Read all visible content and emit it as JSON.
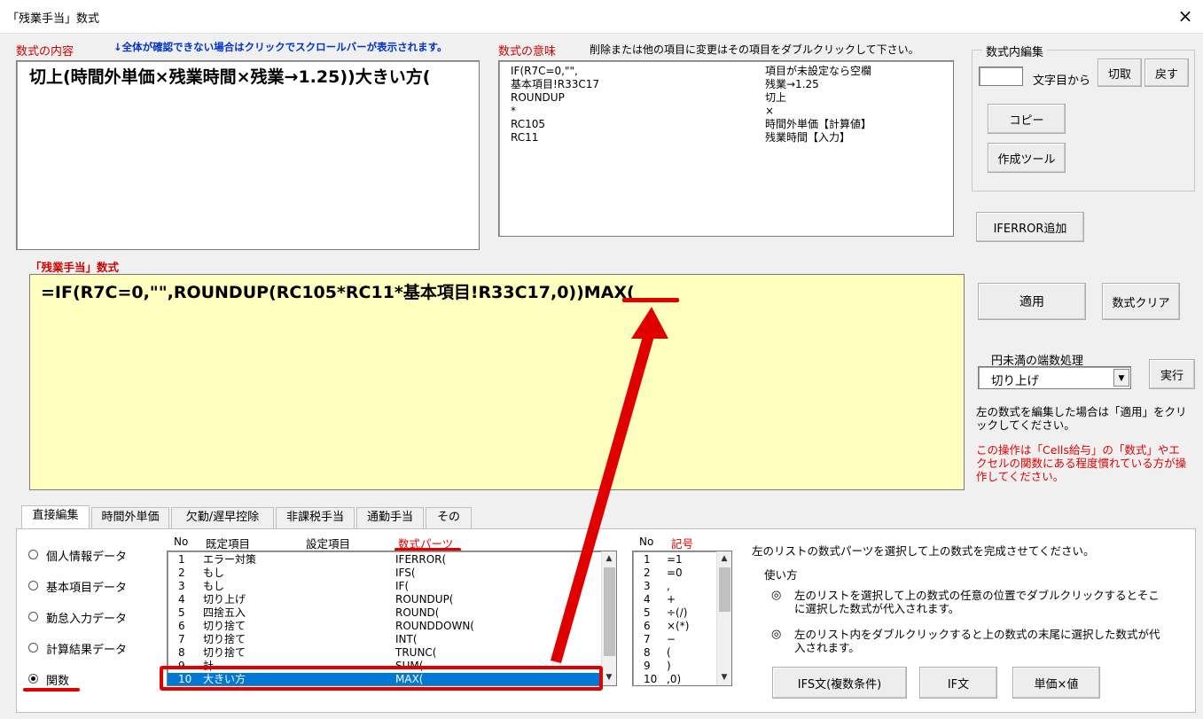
{
  "window": {
    "title": "「残業手当」数式",
    "close_icon": "×"
  },
  "formula_content": {
    "label": "数式の内容",
    "hint": "↓全体が確認できない場合はクリックでスクロールバーが表示されます。",
    "text": "切上(時間外単価×残業時間×残業→1.25))大きい方("
  },
  "formula_meaning": {
    "label": "数式の意味",
    "hint": "削除または他の項目に変更はその項目をダブルクリックして下さい。",
    "rows": [
      {
        "code": "IF(R7C=0,\"\",",
        "meaning": "項目が未設定なら空欄"
      },
      {
        "code": "基本項目!R33C17",
        "meaning": "残業→1.25"
      },
      {
        "code": "ROUNDUP",
        "meaning": "切上"
      },
      {
        "code": "*",
        "meaning": "×"
      },
      {
        "code": "RC105",
        "meaning": "時間外単価【計算値】"
      },
      {
        "code": "RC11",
        "meaning": "残業時間【入力】"
      }
    ]
  },
  "inline_edit": {
    "group_label": "数式内編集",
    "suffix": "文字目から",
    "cut": "切取",
    "back": "戻す",
    "copy": "コピー",
    "tool": "作成ツール"
  },
  "iferror_button": "IFERROR追加",
  "formula": {
    "label": "「残業手当」数式",
    "text": "=IF(R7C=0,\"\",ROUNDUP(RC105*RC11*基本項目!R33C17,0))MAX("
  },
  "apply_button": "適用",
  "clear_button": "数式クリア",
  "rounding": {
    "label": "円未満の端数処理",
    "selected": "切り上げ",
    "run": "実行"
  },
  "notes": {
    "apply_note": "左の数式を編集した場合は「適用」をクリックしてください。",
    "warning": "この操作は「Cells給与」の「数式」やエクセルの関数にある程度慣れている方が操作してください。"
  },
  "tabs": [
    "直接編集",
    "時間外単価",
    "欠勤/遅早控除",
    "非課税手当",
    "通勤手当",
    "その他"
  ],
  "radios": [
    {
      "label": "個人情報データ",
      "checked": false
    },
    {
      "label": "基本項目データ",
      "checked": false
    },
    {
      "label": "勤怠入力データ",
      "checked": false
    },
    {
      "label": "計算結果データ",
      "checked": false
    },
    {
      "label": "関数",
      "checked": true
    }
  ],
  "parts_list": {
    "headers": {
      "no": "No",
      "preset": "既定項目",
      "setting": "設定項目",
      "parts": "数式パーツ"
    },
    "rows": [
      {
        "no": "1",
        "preset": "エラー対策",
        "parts": "IFERROR("
      },
      {
        "no": "2",
        "preset": "もし",
        "parts": "IFS("
      },
      {
        "no": "3",
        "preset": "もし",
        "parts": "IF("
      },
      {
        "no": "4",
        "preset": "切り上げ",
        "parts": "ROUNDUP("
      },
      {
        "no": "5",
        "preset": "四捨五入",
        "parts": "ROUND("
      },
      {
        "no": "6",
        "preset": "切り捨て",
        "parts": "ROUNDDOWN("
      },
      {
        "no": "7",
        "preset": "切り捨て",
        "parts": "INT("
      },
      {
        "no": "8",
        "preset": "切り捨て",
        "parts": "TRUNC("
      },
      {
        "no": "9",
        "preset": "計",
        "parts": "SUM("
      },
      {
        "no": "10",
        "preset": "大きい方",
        "parts": "MAX("
      }
    ]
  },
  "symbol_list": {
    "headers": {
      "no": "No",
      "symbol": "記号"
    },
    "rows": [
      {
        "no": "1",
        "symbol": "=1"
      },
      {
        "no": "2",
        "symbol": "=0"
      },
      {
        "no": "3",
        "symbol": ","
      },
      {
        "no": "4",
        "symbol": "+"
      },
      {
        "no": "5",
        "symbol": "÷(/)"
      },
      {
        "no": "6",
        "symbol": "×(*)"
      },
      {
        "no": "7",
        "symbol": "−"
      },
      {
        "no": "8",
        "symbol": "("
      },
      {
        "no": "9",
        "symbol": ")"
      },
      {
        "no": "10",
        "symbol": ",0)"
      }
    ]
  },
  "help": {
    "intro": "左のリストの数式パーツを選択して上の数式を完成させてください。",
    "usage_title": "使い方",
    "bullet_icon": "◎",
    "bullet1": "左のリストを選択して上の数式の任意の位置でダブルクリックするとそこに選択した数式が代入されます。",
    "bullet2": "左のリスト内をダブルクリックすると上の数式の末尾に選択した数式が代入されます。"
  },
  "bottom_buttons": {
    "ifs": "IFS文(複数条件)",
    "if": "IF文",
    "unit": "単価×値"
  },
  "colors": {
    "highlight": "#ffffc0",
    "accent_red": "#e00000",
    "selection": "#0078d7"
  }
}
